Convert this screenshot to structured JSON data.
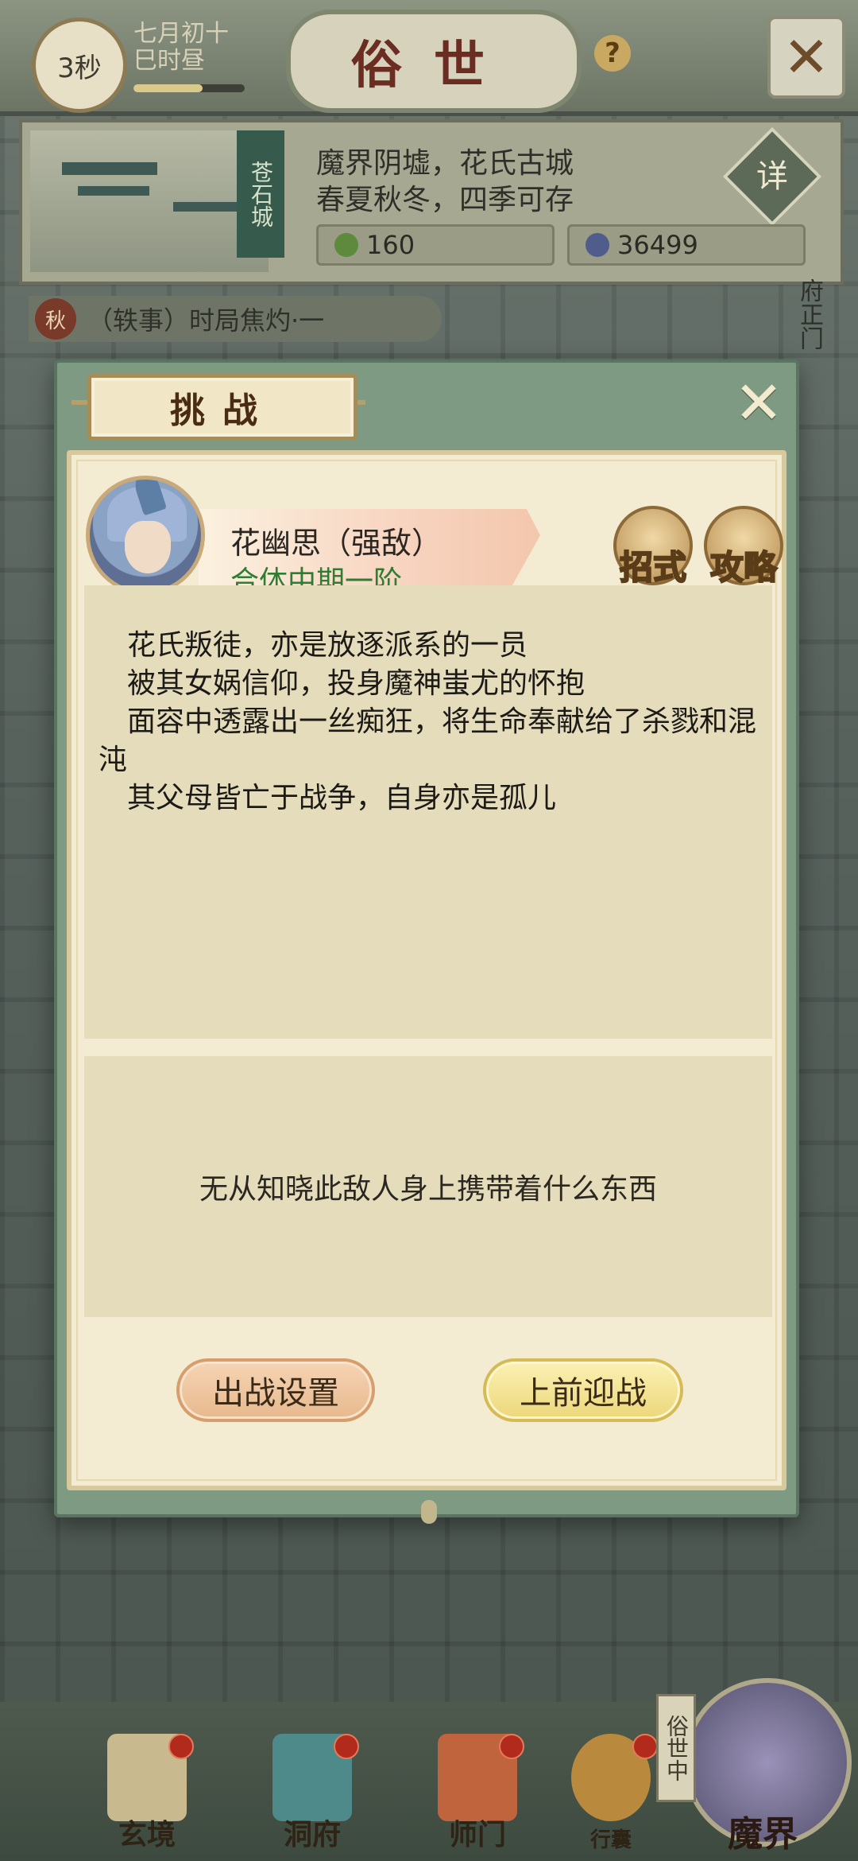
{
  "top_bar": {
    "timer": "3秒",
    "date_line1": "七月初十",
    "date_line2": "巳时昼",
    "title": "俗世",
    "help_icon": "?",
    "close_icon": "✕"
  },
  "location": {
    "city_tag": "苍石城",
    "line1": "魔界阴墟，花氏古城",
    "line2": "春夏秋冬，四季可存",
    "detail_label": "详",
    "resource1": "160",
    "resource2": "36499"
  },
  "quest_bar": {
    "badge": "秋",
    "text": "（轶事）时局焦灼·一"
  },
  "side_text": "府正门",
  "modal": {
    "title": "挑战",
    "close_icon": "✕",
    "enemy_name": "花幽思（强敌）",
    "enemy_rank": "合体中期一阶",
    "skill_label": "招式",
    "guide_label": "攻略",
    "description": [
      "　花氏叛徒，亦是放逐派系的一员",
      "　被其女娲信仰，投身魔神蚩尤的怀抱",
      "　面容中透露出一丝痴狂，将生命奉献给了杀戮和混沌",
      "　其父母皆亡于战争，自身亦是孤儿"
    ],
    "drop_text": "无从知晓此敌人身上携带着什么东西",
    "setup_button": "出战设置",
    "fight_button": "上前迎战"
  },
  "bottom_nav": {
    "items": [
      "玄境",
      "洞府",
      "师门",
      "行囊"
    ],
    "realm_label": "魔界",
    "realm_tag": "俗世中"
  },
  "colors": {
    "accent_green": "#2e7d32",
    "title_red": "#6b2c22",
    "modal_frame": "#7f9a83",
    "parchment": "#f3ecd2"
  }
}
